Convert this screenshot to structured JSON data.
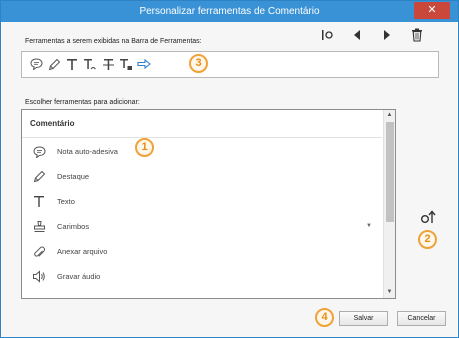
{
  "window": {
    "title": "Personalizar ferramentas de Comentário",
    "close_glyph": "✕"
  },
  "toolbar": {
    "label": "Ferramentas a serem exibidas na Barra de Ferramentas:",
    "top_icons": [
      "add-separator-icon",
      "move-left-icon",
      "move-right-icon",
      "trash-icon"
    ],
    "tools": [
      {
        "icon": "sticky-note-icon"
      },
      {
        "icon": "highlight-icon"
      },
      {
        "icon": "text-icon"
      },
      {
        "icon": "replace-text-icon"
      },
      {
        "icon": "strikethrough-text-icon"
      },
      {
        "icon": "insert-text-icon"
      },
      {
        "icon": "arrow-icon"
      }
    ]
  },
  "chooser": {
    "label": "Escolher ferramentas para adicionar:",
    "header": "Comentário",
    "items": [
      {
        "label": "Nota auto-adesiva",
        "icon": "sticky-note-icon"
      },
      {
        "label": "Destaque",
        "icon": "highlight-icon"
      },
      {
        "label": "Texto",
        "icon": "text-icon"
      },
      {
        "label": "Carimbos",
        "icon": "stamp-icon",
        "has_dropdown": true
      },
      {
        "label": "Anexar arquivo",
        "icon": "attach-file-icon"
      },
      {
        "label": "Gravar áudio",
        "icon": "record-audio-icon"
      }
    ]
  },
  "callouts": [
    "1",
    "2",
    "3",
    "4"
  ],
  "buttons": {
    "save": "Salvar",
    "cancel": "Cancelar"
  },
  "colors": {
    "titlebar": "#3a92d6",
    "close": "#c9483b",
    "callout": "#f0a23a",
    "arrow_accent": "#2f7fd0"
  }
}
